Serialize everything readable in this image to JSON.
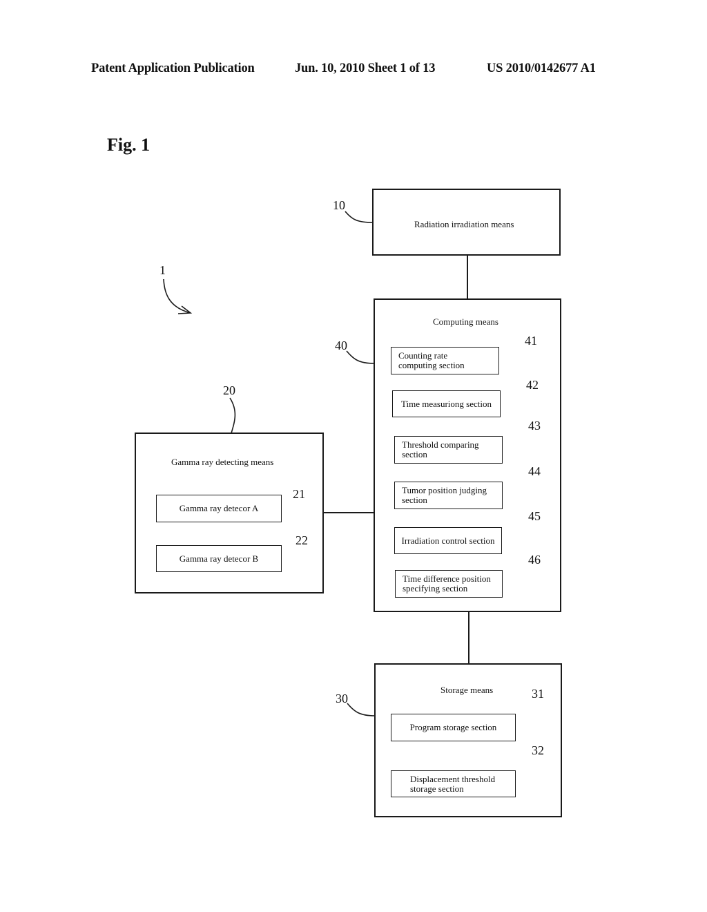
{
  "header": {
    "publication": "Patent Application Publication",
    "date_sheet": "Jun. 10, 2010  Sheet 1 of 13",
    "number": "US 2010/0142677 A1"
  },
  "figure": {
    "title": "Fig. 1",
    "system_ref": "1"
  },
  "blocks": {
    "radiation": {
      "ref": "10",
      "label": "Radiation irradiation means"
    },
    "computing": {
      "ref": "40",
      "label": "Computing means",
      "sections": [
        {
          "ref": "41",
          "label": "Counting rate\ncomputing section"
        },
        {
          "ref": "42",
          "label": "Time measuriong section"
        },
        {
          "ref": "43",
          "label": "Threshold comparing\nsection"
        },
        {
          "ref": "44",
          "label": "Tumor position judging\nsection"
        },
        {
          "ref": "45",
          "label": "Irradiation control section"
        },
        {
          "ref": "46",
          "label": "Time difference position\nspecifying section"
        }
      ]
    },
    "gamma": {
      "ref": "20",
      "label": "Gamma ray detecting means",
      "sections": [
        {
          "ref": "21",
          "label": "Gamma ray detecor A"
        },
        {
          "ref": "22",
          "label": "Gamma ray detecor B"
        }
      ]
    },
    "storage": {
      "ref": "30",
      "label": "Storage means",
      "sections": [
        {
          "ref": "31",
          "label": "Program storage section"
        },
        {
          "ref": "32",
          "label": "Displacement threshold\nstorage section"
        }
      ]
    }
  }
}
